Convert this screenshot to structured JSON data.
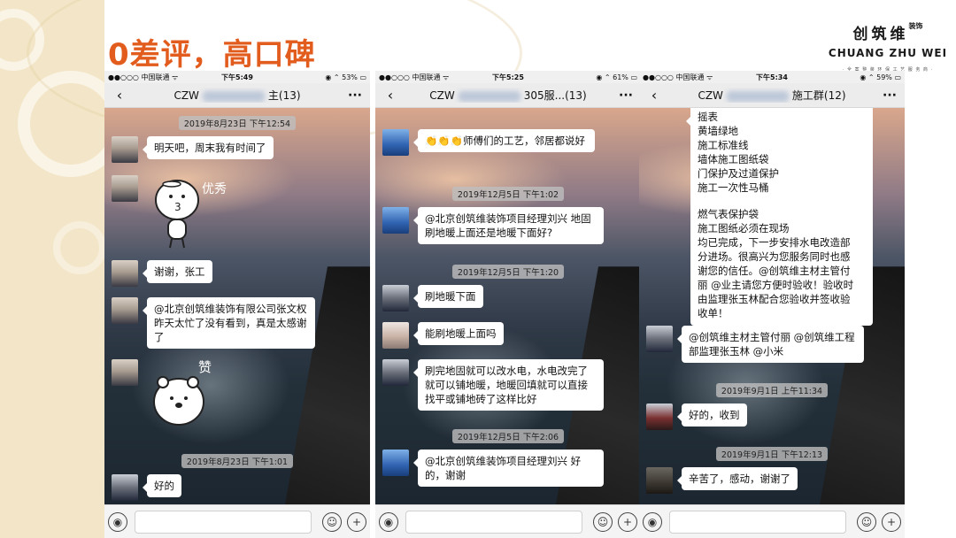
{
  "slide": {
    "title": "0差评，高口碑",
    "logo_cn": "创筑维",
    "logo_cn_mini": "装饰",
    "logo_en": "CHUANG ZHU WEI",
    "logo_sub": "· 全 案 整 装 环 保 工 艺 服 务 商 ·"
  },
  "phones": [
    {
      "status": {
        "carrier": "●●○○○ 中国联通 ᯤ",
        "time": "下午5:49",
        "battery": "◉ ⌃ 53% ▭"
      },
      "chat_title_prefix": "CZW",
      "chat_title_suffix": "主(13)",
      "stamps": [
        "2019年8月23日 下午12:54",
        "2019年8月23日 下午1:01"
      ],
      "messages": [
        "明天吧，周末我有时间了",
        "谢谢，张工",
        "@北京创筑维装饰有限公司张文权 昨天太忙了没有看到，真是太感谢了",
        "好的"
      ],
      "stickers": [
        "优秀",
        "赞"
      ]
    },
    {
      "status": {
        "carrier": "●●○○○ 中国联通 ᯤ",
        "time": "下午5:25",
        "battery": "◉ ⌃ 61% ▭"
      },
      "chat_title_prefix": "CZW",
      "chat_title_suffix": "305服...(13)",
      "stamps": [
        "2019年12月5日 下午1:02",
        "2019年12月5日 下午1:20",
        "2019年12月5日 下午2:06"
      ],
      "messages": [
        "👏👏👏师傅们的工艺，邻居都说好",
        "@北京创筑维装饰项目经理刘兴 地固刷地暖上面还是地暖下面好?",
        "刷地暖下面",
        "能刷地暖上面吗",
        "刷完地固就可以改水电，水电改完了就可以铺地暖，地暖回填就可以直接找平或铺地砖了这样比好",
        "@北京创筑维装饰项目经理刘兴 好的，谢谢"
      ]
    },
    {
      "status": {
        "carrier": "●●○○○ 中国联通 ᯤ",
        "time": "下午5:34",
        "battery": "◉ ⌃ 59% ▭"
      },
      "chat_title_prefix": "CZW",
      "chat_title_suffix": "施工群(12)",
      "stamps": [
        "2019年9月1日 上午11:34",
        "2019年9月1日 下午12:13"
      ],
      "long_message_lines": [
        "摇表",
        "黄墙绿地",
        "施工标准线",
        "墙体施工图纸袋",
        "门保护及过道保护",
        "施工一次性马桶",
        "",
        "燃气表保护袋",
        "施工图纸必须在现场",
        "均已完成，下一步安排水电改造部",
        "分进场。很高兴为您服务同时也感",
        "谢您的信任。@创筑维主材主管付",
        "丽 @业主请您方便时验收！验收时",
        "由监理张玉林配合您验收并签收验",
        "收单！"
      ],
      "messages": [
        "@创筑维主材主管付丽 @创筑维工程部监理张玉林 @小米",
        "好的，收到",
        "辛苦了，感动，谢谢了"
      ]
    }
  ]
}
